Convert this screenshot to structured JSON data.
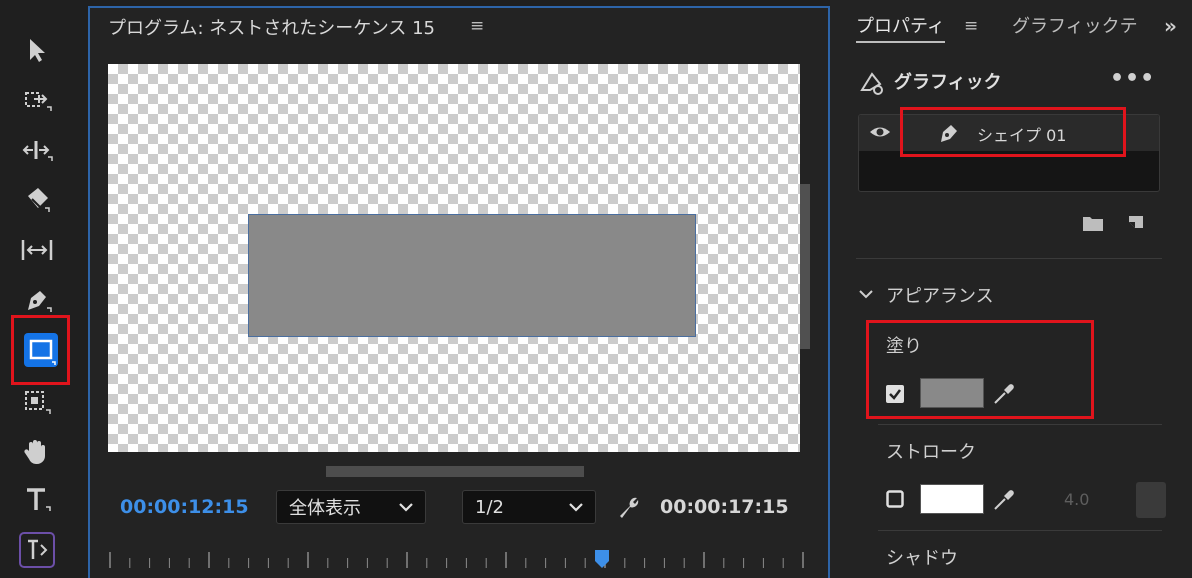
{
  "toolbar": {
    "tools": [
      {
        "name": "selection-tool"
      },
      {
        "name": "track-select-tool"
      },
      {
        "name": "ripple-edit-tool"
      },
      {
        "name": "razor-tool"
      },
      {
        "name": "slip-tool"
      },
      {
        "name": "pen-tool"
      },
      {
        "name": "rectangle-tool",
        "selected": true
      },
      {
        "name": "hand-tool"
      },
      {
        "name": "type-tool"
      },
      {
        "name": "vertical-type-tool"
      }
    ]
  },
  "program_monitor": {
    "title": "プログラム: ネストされたシーケンス 15",
    "menu_icon": "hamburger-icon",
    "current_time": "00:00:12:15",
    "zoom_select": {
      "value": "全体表示"
    },
    "resolution_select": {
      "value": "1/2"
    },
    "settings_icon": "wrench-icon",
    "duration": "00:00:17:15",
    "shape_fill_color": "#898989"
  },
  "properties_panel": {
    "tabs": [
      {
        "label": "プロパティ",
        "active": true
      },
      {
        "label": "グラフィックテ",
        "active": false
      }
    ],
    "overflow_icon": "double-chevron-right-icon",
    "section_title": "グラフィック",
    "more_icon": "ellipsis-icon",
    "layers": [
      {
        "name": "シェイプ 01",
        "visible": true,
        "icon": "pen-icon"
      }
    ],
    "appearance": {
      "title": "アピアランス",
      "fill": {
        "label": "塗り",
        "enabled": true,
        "color": "#898989"
      },
      "stroke": {
        "label": "ストローク",
        "enabled": false,
        "color": "#ffffff",
        "width": "4.0"
      },
      "shadow": {
        "label": "シャドウ"
      }
    }
  },
  "colors": {
    "accent_blue": "#1473e6",
    "highlight_red": "#e0141c",
    "timecode_blue": "#3d8fe8"
  }
}
